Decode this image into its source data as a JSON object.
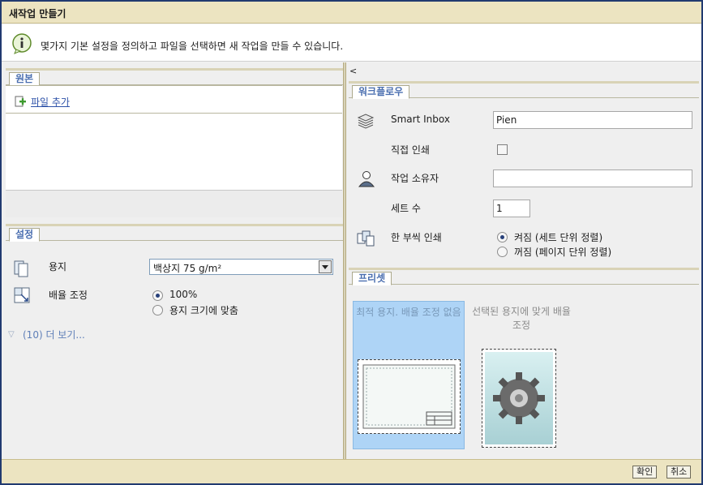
{
  "window": {
    "title": "새작업 만들기"
  },
  "info": {
    "message": "몇가지 기본 설정을 정의하고 파일을 선택하면 새 작업을 만들 수 있습니다.",
    "icon": "info-icon"
  },
  "original": {
    "section_title": "원본",
    "add_file_label": "파일 추가"
  },
  "settings": {
    "section_title": "설정",
    "paper_label": "용지",
    "paper_value": "백상지 75 g/m²",
    "scale_label": "배율 조정",
    "scale_options": [
      "100%",
      "용지 크기에 맞춤"
    ],
    "scale_selected": 0,
    "more_link": "(10) 더 보기..."
  },
  "workflow": {
    "collapse_label": "<",
    "section_title": "워크플로우",
    "smart_inbox_label": "Smart Inbox",
    "smart_inbox_value": "Pien",
    "direct_print_label": "직접 인쇄",
    "direct_print_checked": false,
    "owner_label": "작업 소유자",
    "owner_value": "",
    "sets_label": "세트 수",
    "sets_value": "1",
    "collate_label": "한 부씩 인쇄",
    "collate_options": [
      "켜짐 (세트 단위 정렬)",
      "꺼짐 (페이지 단위 정렬)"
    ],
    "collate_selected": 0
  },
  "presets": {
    "section_title": "프리셋",
    "cards": [
      {
        "caption": "최적 용지. 배율 조정 없음",
        "selected": true
      },
      {
        "caption": "선택된 용지에 맞게 배율 조정",
        "selected": false
      }
    ]
  },
  "footer": {
    "ok_label": "확인",
    "cancel_label": "취소"
  },
  "colors": {
    "title_bar": "#ece4c1",
    "window_border": "#213a70",
    "tab_text": "#4b6fb0",
    "link": "#2e52a8",
    "preset_selected": "#aed4f6"
  }
}
